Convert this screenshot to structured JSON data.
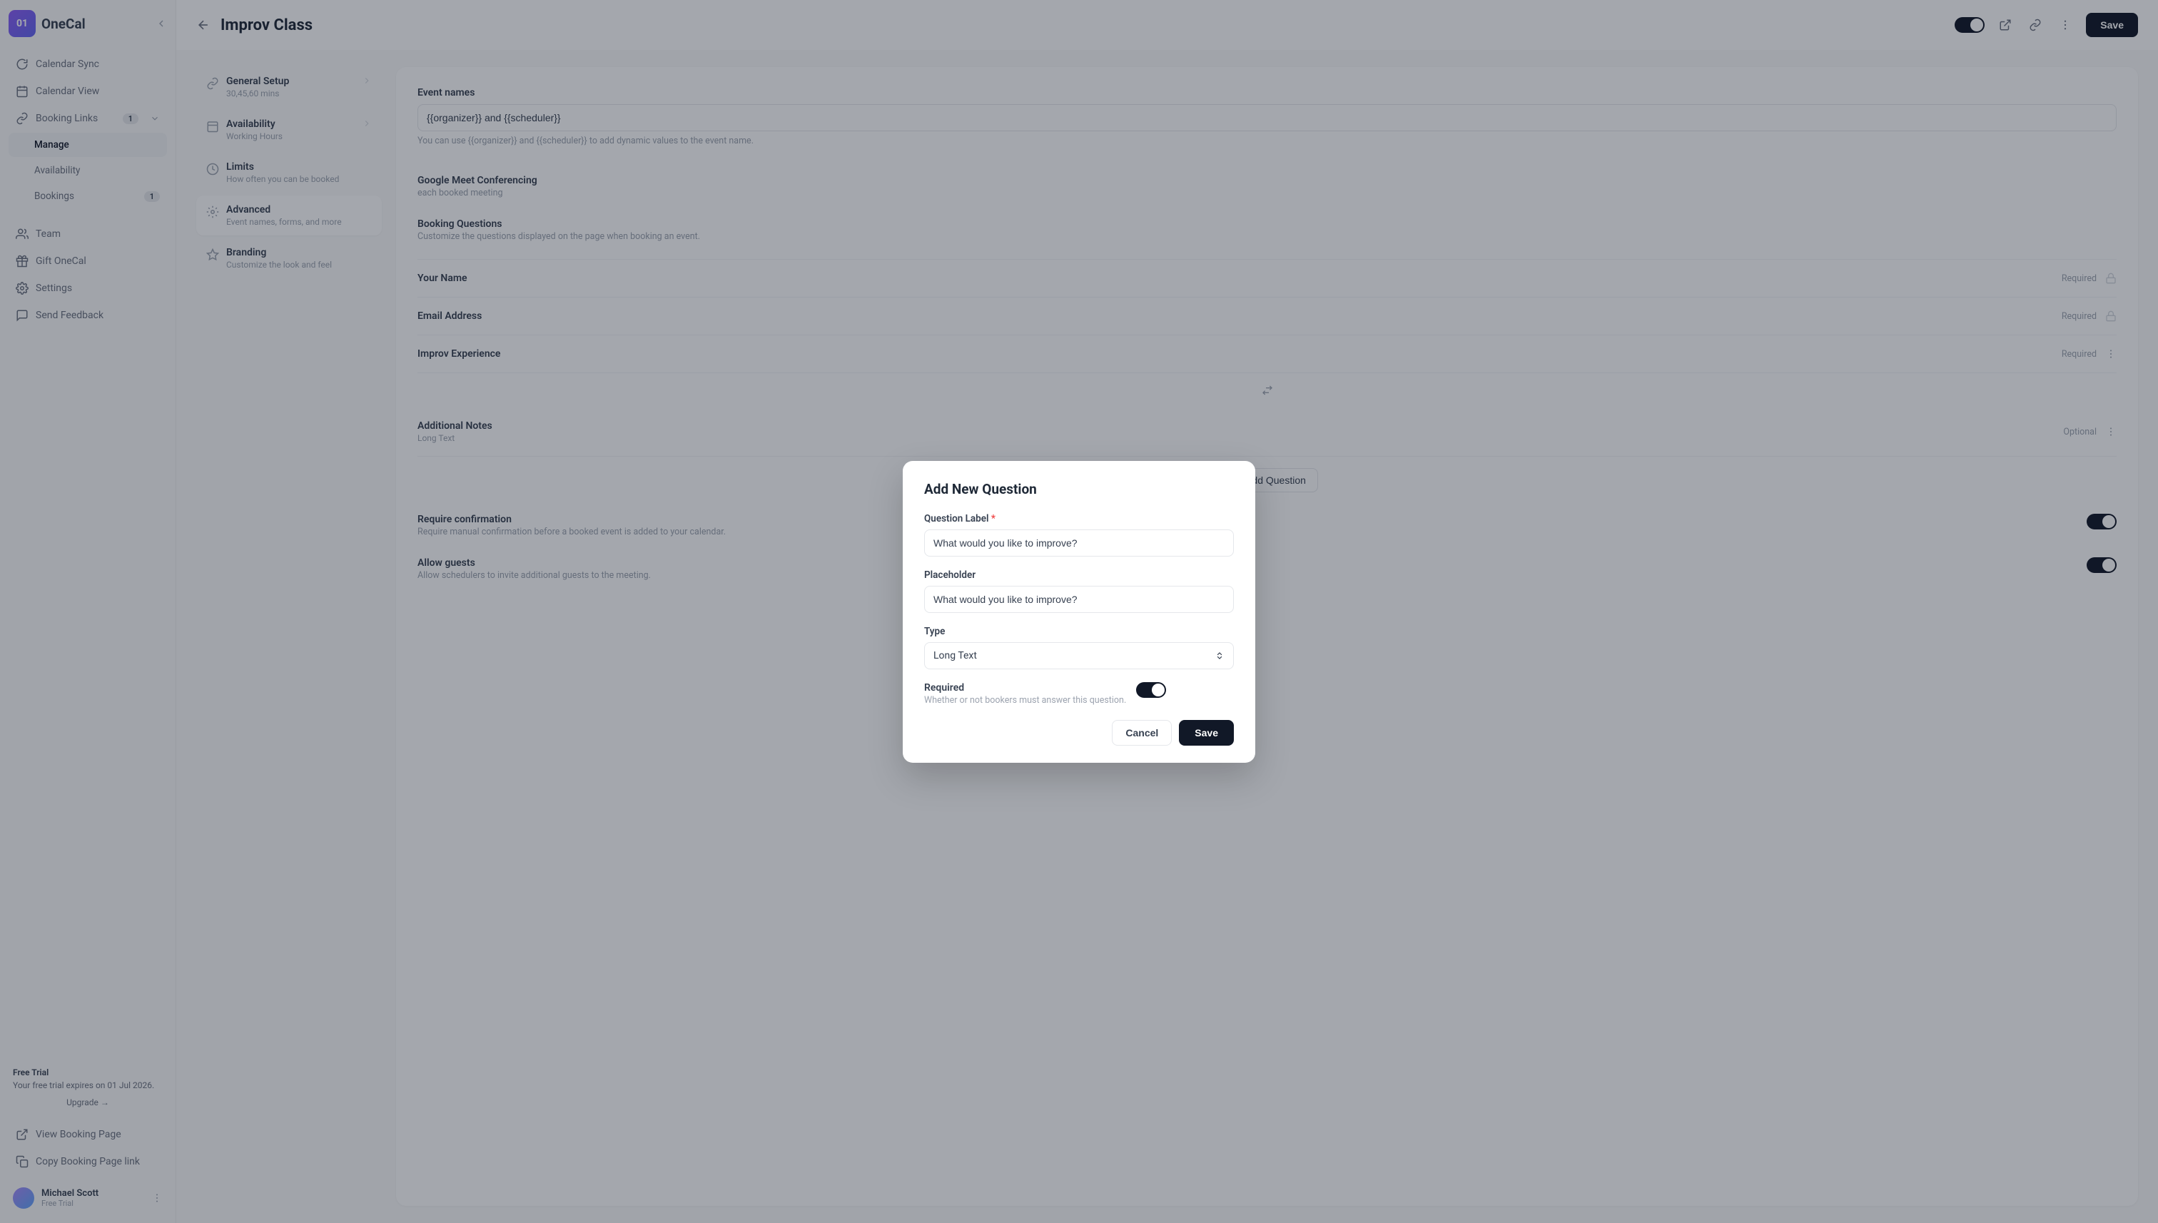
{
  "brand": {
    "name": "OneCal",
    "badge": "01"
  },
  "sidebar": {
    "items": [
      {
        "label": "Calendar Sync"
      },
      {
        "label": "Calendar View"
      },
      {
        "label": "Booking Links",
        "badge": "1"
      },
      {
        "label": "Manage"
      },
      {
        "label": "Availability"
      },
      {
        "label": "Bookings",
        "badge": "1"
      },
      {
        "label": "Team"
      },
      {
        "label": "Gift OneCal"
      },
      {
        "label": "Settings"
      },
      {
        "label": "Send Feedback"
      }
    ],
    "trial": {
      "title": "Free Trial",
      "body": "Your free trial expires on 01 Jul 2026.",
      "upgrade": "Upgrade →"
    },
    "bottom": {
      "view": "View Booking Page",
      "copy": "Copy Booking Page link"
    },
    "user": {
      "name": "Michael Scott",
      "plan": "Free Trial"
    }
  },
  "header": {
    "title": "Improv Class",
    "save": "Save"
  },
  "settings_nav": [
    {
      "label": "General Setup",
      "desc": "30,45,60 mins"
    },
    {
      "label": "Availability",
      "desc": "Working Hours"
    },
    {
      "label": "Limits",
      "desc": "How often you can be booked"
    },
    {
      "label": "Advanced",
      "desc": "Event names, forms, and more"
    },
    {
      "label": "Branding",
      "desc": "Customize the look and feel"
    }
  ],
  "panel": {
    "event_names": {
      "label": "Event names",
      "value": "{{organizer}} and {{scheduler}}",
      "help": "You can use {{organizer}} and {{scheduler}} to add dynamic values to the event name."
    },
    "google_meet": {
      "title": "Google Meet Conferencing",
      "desc_end": "each booked meeting"
    },
    "booking_questions": {
      "title": "Booking Questions",
      "desc": "Customize the questions displayed on the page when booking an event."
    },
    "questions": [
      {
        "title": "Your Name",
        "type": "",
        "tag": "Required",
        "locked": true
      },
      {
        "title": "Email Address",
        "type": "",
        "tag": "Required",
        "locked": true
      },
      {
        "title": "Improv Experience",
        "type": "",
        "tag": "Required",
        "locked": false
      },
      {
        "title": "Additional Notes",
        "type": "Long Text",
        "tag": "Optional",
        "locked": false
      }
    ],
    "add_question": "Add Question",
    "require_confirmation": {
      "title": "Require confirmation",
      "desc": "Require manual confirmation before a booked event is added to your calendar."
    },
    "allow_guests": {
      "title": "Allow guests",
      "desc": "Allow schedulers to invite additional guests to the meeting."
    }
  },
  "modal": {
    "title": "Add New Question",
    "label_field": "Question Label",
    "label_value": "What would you like to improve?",
    "placeholder_field": "Placeholder",
    "placeholder_value": "What would you like to improve?",
    "type_field": "Type",
    "type_value": "Long Text",
    "required_title": "Required",
    "required_desc": "Whether or not bookers must answer this question.",
    "cancel": "Cancel",
    "save": "Save"
  }
}
